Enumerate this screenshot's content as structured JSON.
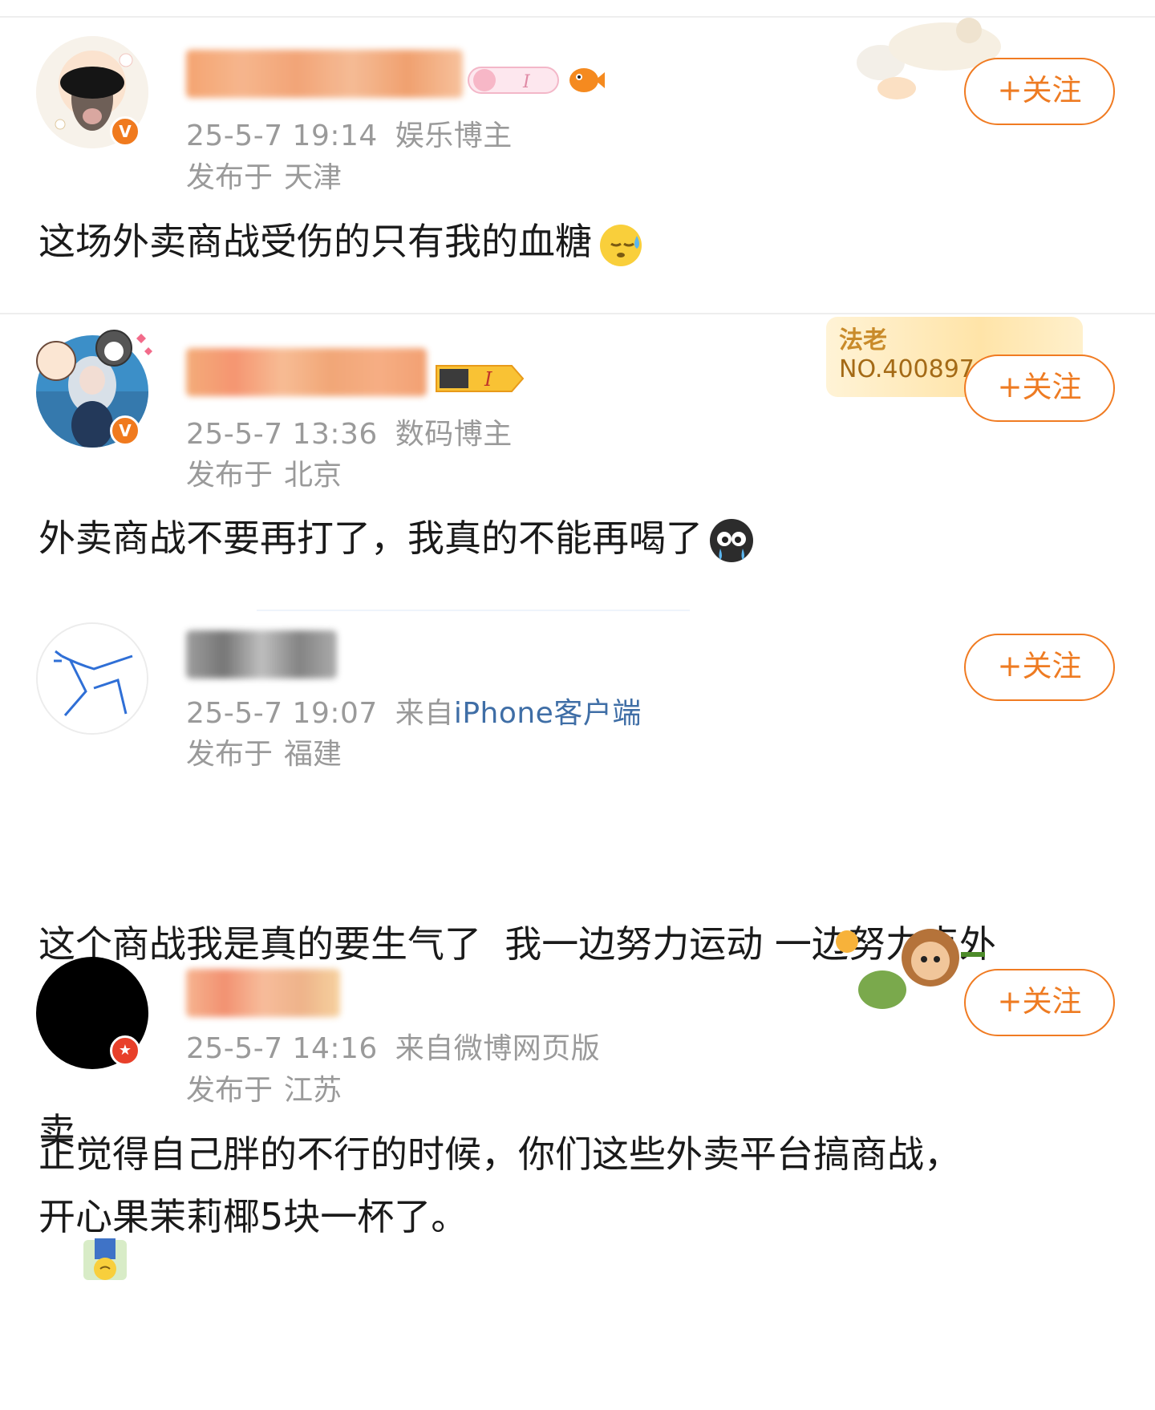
{
  "posts": [
    {
      "time": "25-5-7 19:14",
      "meta": "娱乐博主",
      "location_prefix": "发布于",
      "location": "天津",
      "follow_label": "+关注",
      "content": "这场外卖商战受伤的只有我的血糖",
      "emoji": "sweat-face-emoji"
    },
    {
      "time": "25-5-7 13:36",
      "meta": "数码博主",
      "location_prefix": "发布于",
      "location": "北京",
      "follow_label": "+关注",
      "card_label": "法老",
      "card_no": "NO.400897",
      "content": "外卖商战不要再打了，我真的不能再喝了",
      "emoji": "crying-face-emoji"
    },
    {
      "time": "25-5-7 19:07",
      "meta_prefix": "来自",
      "meta_link": "iPhone客户端",
      "location_prefix": "发布于",
      "location": "福建",
      "follow_label": "+关注",
      "content_line1": "这个商战我是真的要生气了  我一边努力运动 一边努力点外",
      "content_line2": "卖",
      "emoji": "upside-down-person-emoji"
    },
    {
      "time": "25-5-7 14:16",
      "meta": "来自微博网页版",
      "location_prefix": "发布于",
      "location": "江苏",
      "follow_label": "+关注",
      "content_line1": "正觉得自己胖的不行的时候，你们这些外卖平台搞商战，",
      "content_line2": "开心果茉莉椰5块一杯了。"
    }
  ],
  "colors": {
    "accent": "#f07b22",
    "meta_gray": "#9a9a9a",
    "link_blue": "#3f6ea6",
    "verified_orange": "#f07a1e",
    "verified_red": "#e8402a"
  }
}
